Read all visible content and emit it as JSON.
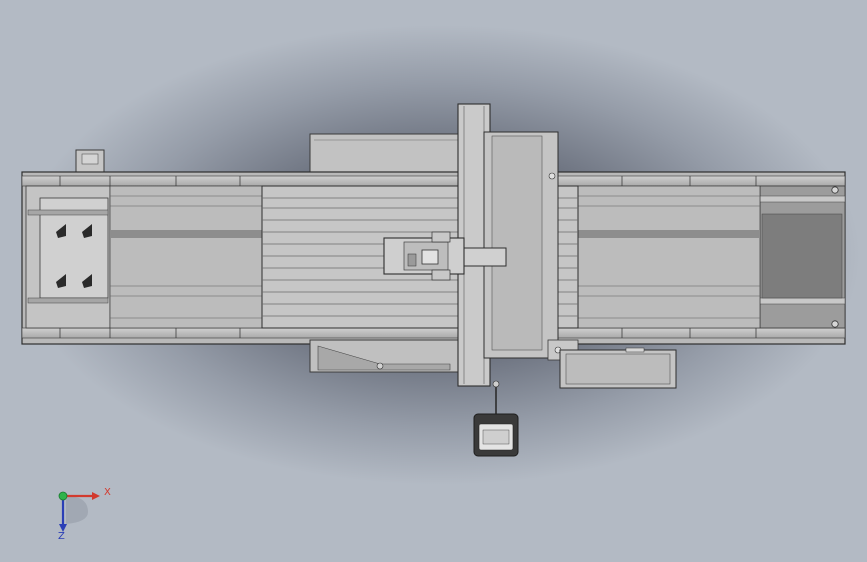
{
  "view": {
    "background_center": "#4b4f58",
    "background_edge": "#b3bac4",
    "part_fill": "#bdbdbd",
    "part_dark": "#8a8a8a",
    "edge_color": "#3a3a3a"
  },
  "triad": {
    "x_label": "X",
    "z_label": "Z",
    "x_color": "#d23a2e",
    "z_color": "#2b3fb6",
    "y_color": "#2fb34a"
  }
}
